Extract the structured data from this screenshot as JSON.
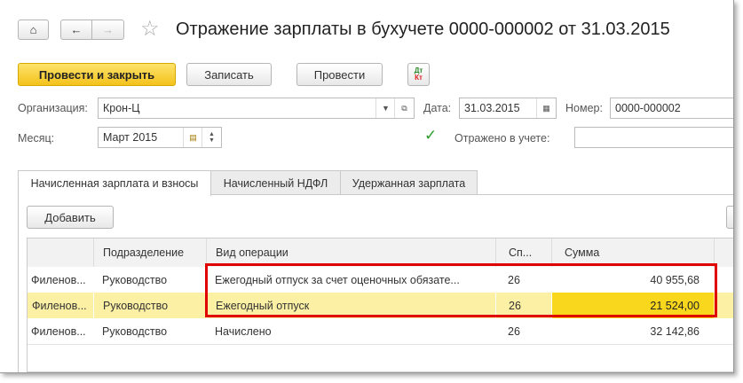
{
  "title": "Отражение зарплаты в бухучете 0000-000002 от 31.03.2015",
  "toolbar": {
    "post_close": "Провести и закрыть",
    "save": "Записать",
    "post": "Провести",
    "dt": "Дт",
    "kt": "Кт"
  },
  "form": {
    "org_label": "Организация:",
    "org_value": "Крон-Ц",
    "date_label": "Дата:",
    "date_value": "31.03.2015",
    "number_label": "Номер:",
    "number_value": "0000-000002",
    "month_label": "Месяц:",
    "month_value": "Март 2015",
    "reflected_label": "Отражено в учете:",
    "reflected_value": ""
  },
  "tabs": [
    "Начисленная зарплата и взносы",
    "Начисленный НДФЛ",
    "Удержанная зарплата"
  ],
  "add_label": "Добавить",
  "table": {
    "headers": [
      "",
      "Подразделение",
      "Вид операции",
      "Сп...",
      "Сумма"
    ],
    "rows": [
      {
        "fio": "Филенов...",
        "dept": "Руководство",
        "op": "Ежегодный отпуск за счет оценочных обязате...",
        "acc": "26",
        "sum": "40 955,68"
      },
      {
        "fio": "Филенов...",
        "dept": "Руководство",
        "op": "Ежегодный отпуск",
        "acc": "26",
        "sum": "21 524,00"
      },
      {
        "fio": "Филенов...",
        "dept": "Руководство",
        "op": "Начислено",
        "acc": "26",
        "sum": "32 142,86"
      }
    ]
  },
  "colors": {
    "accent": "#f4c21c",
    "selected_row": "#fbf0a4",
    "selected_cell": "#f9d71c",
    "highlight_box": "#e00000"
  }
}
